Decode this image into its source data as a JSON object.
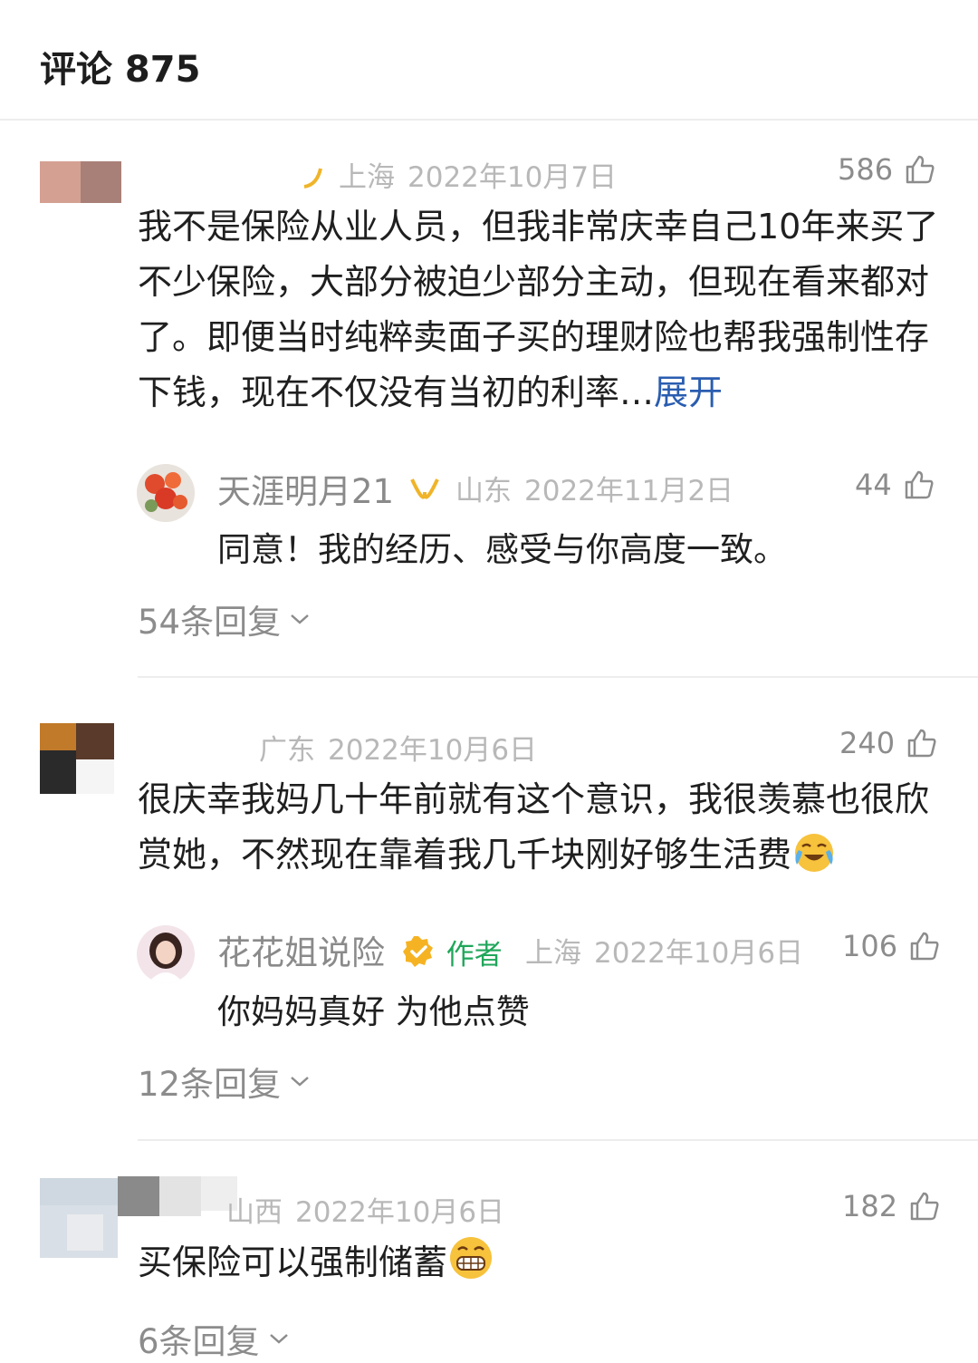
{
  "header": {
    "title": "评论 875"
  },
  "comments": [
    {
      "location": "上海",
      "date": "2022年10月7日",
      "likes": "586",
      "text": "我不是保险从业人员，但我非常庆幸自己10年来买了不少保险，大部分被迫少部分主动，但现在看来都对了。即便当时纯粹卖面子买的理财险也帮我强制性存下钱，现在不仅没有当初的利率…",
      "expand_label": "展开",
      "reply": {
        "username": "天涯明月21",
        "location": "山东",
        "date": "2022年11月2日",
        "likes": "44",
        "text": "同意！我的经历、感受与你高度一致。"
      },
      "reply_count_label": "54条回复"
    },
    {
      "location": "广东",
      "date": "2022年10月6日",
      "likes": "240",
      "text": "很庆幸我妈几十年前就有这个意识，我很羡慕也很欣赏她，不然现在靠着我几千块刚好够生活费",
      "reply": {
        "username": "花花姐说险",
        "author_tag": "作者",
        "location": "上海",
        "date": "2022年10月6日",
        "likes": "106",
        "text": "你妈妈真好 为他点赞"
      },
      "reply_count_label": "12条回复"
    },
    {
      "location": "山西",
      "date": "2022年10月6日",
      "likes": "182",
      "text": "买保险可以强制储蓄",
      "reply_count_label": "6条回复"
    }
  ],
  "icons": {
    "like": "thumbs-up-icon",
    "chevron": "chevron-down-icon",
    "verified": "verified-badge-icon",
    "emoji_cry": "crying-laughing-emoji",
    "emoji_grin": "grinning-emoji"
  },
  "colors": {
    "author_tag": "#1fa65a",
    "expand_link": "#2a5db0",
    "verified_badge": "#f5b323"
  }
}
